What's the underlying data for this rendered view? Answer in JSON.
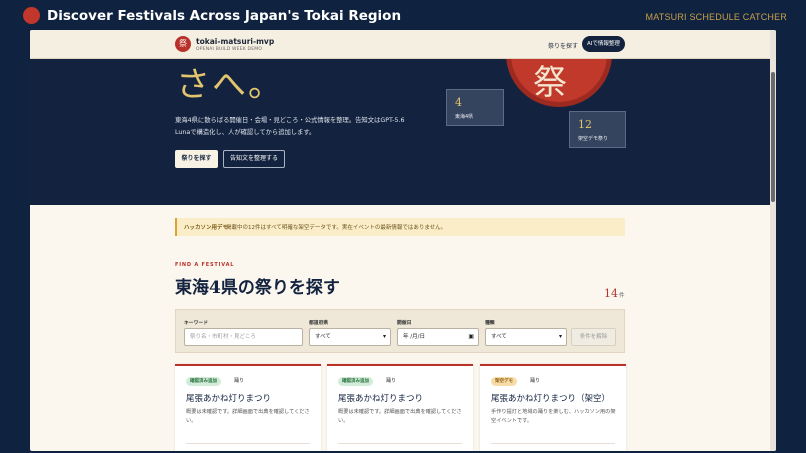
{
  "slide": {
    "title": "Discover Festivals Across Japan's Tokai Region",
    "brand": "MATSURI SCHEDULE CATCHER"
  },
  "nav": {
    "logo_glyph": "祭",
    "app_name": "tokai-matsuri-mvp",
    "app_sub": "OPENAI BUILD WEEK DEMO",
    "find_link": "祭りを探す",
    "cta": "AIで情報整理"
  },
  "hero": {
    "headline_tail": "さへ。",
    "description": "東海4県に散らばる開催日・会場・見どころ・公式情報を整理。告知文はGPT-5.6 Lunaで構造化し、人が確認してから追加します。",
    "primary_button": "祭りを探す",
    "secondary_button": "告知文を整理する",
    "sun_glyph": "祭",
    "stats": [
      {
        "value": "4",
        "label": "東海4県"
      },
      {
        "value": "12",
        "label": "架空デモ祭り"
      }
    ]
  },
  "notice": {
    "tag": "ハッカソン用デモ",
    "text": "掲載中の12件はすべて明確な架空データです。実在イベントの最新情報ではありません。"
  },
  "search": {
    "kicker": "FIND A FESTIVAL",
    "title": "東海4県の祭りを探す",
    "count": "14",
    "count_unit": "件",
    "filters": {
      "keyword_label": "キーワード",
      "keyword_placeholder": "祭り名・市町村・見どころ",
      "prefecture_label": "都道府県",
      "prefecture_value": "すべて",
      "date_label": "開催日",
      "date_value": "年 /月/日",
      "genre_label": "種類",
      "genre_value": "すべて",
      "reset": "条件を解除"
    }
  },
  "cards": [
    {
      "badge": "確認済み追加",
      "genre": "踊り",
      "title": "尾張あかね灯りまつり",
      "desc": "概要は未確認です。詳細画面で出典を確認してください。"
    },
    {
      "badge": "確認済み追加",
      "genre": "踊り",
      "title": "尾張あかね灯りまつり",
      "desc": "概要は未確認です。詳細画面で出典を確認してください。"
    },
    {
      "badge": "架空デモ",
      "genre": "踊り",
      "title": "尾張あかね灯りまつり（架空）",
      "desc": "手作り提灯と地域の踊りを楽しむ、ハッカソン用の架空イベントです。"
    }
  ],
  "colors": {
    "navy": "#13233f",
    "accent_red": "#b8322a",
    "gold": "#e3c46f",
    "cream": "#fbf7ee"
  }
}
